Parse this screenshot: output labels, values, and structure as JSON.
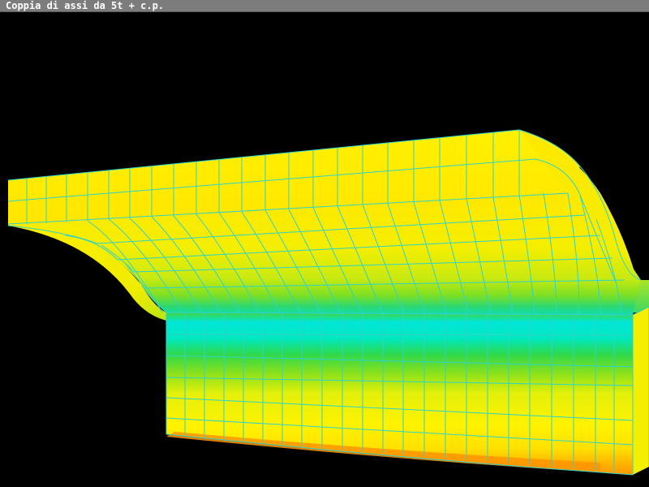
{
  "window": {
    "title": "Coppia di assi da 5t + c.p."
  },
  "viewport": {
    "background": "#000000",
    "mesh_color": "#2fd3c8",
    "colormap": [
      "#00e6d8",
      "#1fe07a",
      "#3fd640",
      "#8fe21a",
      "#d8ee08",
      "#fff200",
      "#ffd600",
      "#ff9a00"
    ]
  }
}
